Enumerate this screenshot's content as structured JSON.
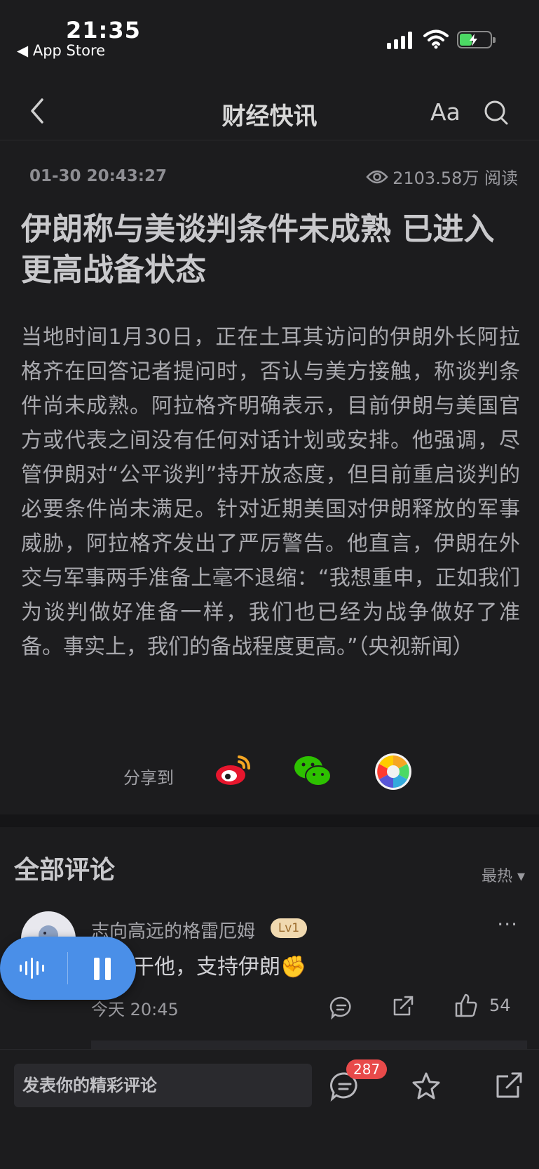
{
  "status_bar": {
    "time": "21:35",
    "back_app": "◀ App Store",
    "battery_color": "#4cd964"
  },
  "nav": {
    "title": "财经快讯",
    "font_button": "Aa",
    "back_icon": "chevron-left-icon",
    "search_icon": "search-icon"
  },
  "article": {
    "datetime": "01-30 20:43:27",
    "views": "2103.58万 阅读",
    "headline": "伊朗称与美谈判条件未成熟 已进入更高战备状态",
    "body": "当地时间1月30日，正在土耳其访问的伊朗外长阿拉格齐在回答记者提问时，否认与美方接触，称谈判条件尚未成熟。阿拉格齐明确表示，目前伊朗与美国官方或代表之间没有任何对话计划或安排。他强调，尽管伊朗对“公平谈判”持开放态度，但目前重启谈判的必要条件尚未满足。针对近期美国对伊朗释放的军事威胁，阿拉格齐发出了严厉警告。他直言，伊朗在外交与军事两手准备上毫不退缩：“我想重申，正如我们为谈判做好准备一样，我们也已经为战争做好了准备。事实上，我们的备战程度更高。”（央视新闻）"
  },
  "share": {
    "label": "分享到",
    "targets": [
      "weibo-icon",
      "wechat-icon",
      "moments-icon"
    ]
  },
  "comments": {
    "title": "全部评论",
    "sort": "最热 ▾",
    "items": [
      {
        "user": "志向高远的格雷厄姆",
        "level": "Lv1",
        "text": "就要干他，支持伊朗✊",
        "time": "今天 20:45",
        "likes": "54"
      }
    ]
  },
  "audio_player": {
    "accent": "#4a8fe8",
    "state": "playing"
  },
  "bottom_bar": {
    "input_placeholder": "发表你的精彩评论",
    "comment_count": "287",
    "badge_color": "#e84a4a"
  }
}
